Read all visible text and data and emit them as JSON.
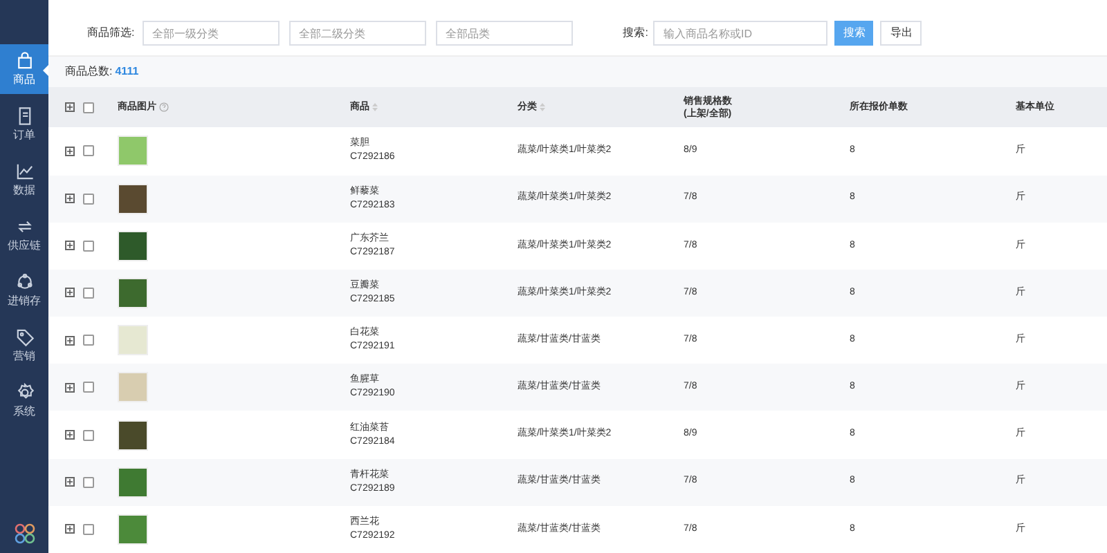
{
  "sidebar": {
    "items": [
      {
        "label": "商品",
        "selected": true
      },
      {
        "label": "订单",
        "selected": false
      },
      {
        "label": "数据",
        "selected": false
      },
      {
        "label": "供应链",
        "selected": false
      },
      {
        "label": "进销存",
        "selected": false
      },
      {
        "label": "营销",
        "selected": false
      },
      {
        "label": "系统",
        "selected": false
      }
    ]
  },
  "filter": {
    "label": "商品筛选:",
    "selects": [
      {
        "placeholder": "全部一级分类"
      },
      {
        "placeholder": "全部二级分类"
      },
      {
        "placeholder": "全部品类"
      }
    ],
    "search_label": "搜索:",
    "search": {
      "placeholder": "输入商品名称或ID"
    },
    "search_button": "搜索",
    "export_button": "导出"
  },
  "summary": {
    "label": "商品总数:",
    "count": "4111"
  },
  "table": {
    "all_checked": false,
    "columns": [
      {
        "label": "商品图片"
      },
      {
        "label": "商品"
      },
      {
        "label": "分类"
      },
      {
        "label": "销售规格数",
        "sublabel": "(上架/全部)"
      },
      {
        "label": "所在报价单数"
      },
      {
        "label": "基本单位"
      }
    ],
    "rows": [
      {
        "name": "菜胆",
        "id": "C7292186",
        "category": "蔬菜/叶菜类1/叶菜类2",
        "specs": "8/9",
        "quotes": "8",
        "unit": "斤",
        "checked": false,
        "color": "#8fc86a"
      },
      {
        "name": "鲜藜菜",
        "id": "C7292183",
        "category": "蔬菜/叶菜类1/叶菜类2",
        "specs": "7/8",
        "quotes": "8",
        "unit": "斤",
        "checked": false,
        "color": "#5a4a30"
      },
      {
        "name": "广东芥兰",
        "id": "C7292187",
        "category": "蔬菜/叶菜类1/叶菜类2",
        "specs": "7/8",
        "quotes": "8",
        "unit": "斤",
        "checked": false,
        "color": "#2e5a2a"
      },
      {
        "name": "豆瓣菜",
        "id": "C7292185",
        "category": "蔬菜/叶菜类1/叶菜类2",
        "specs": "7/8",
        "quotes": "8",
        "unit": "斤",
        "checked": false,
        "color": "#3d6a2e"
      },
      {
        "name": "白花菜",
        "id": "C7292191",
        "category": "蔬菜/甘蓝类/甘蓝类",
        "specs": "7/8",
        "quotes": "8",
        "unit": "斤",
        "checked": false,
        "color": "#e6e8d2"
      },
      {
        "name": "鱼腥草",
        "id": "C7292190",
        "category": "蔬菜/甘蓝类/甘蓝类",
        "specs": "7/8",
        "quotes": "8",
        "unit": "斤",
        "checked": false,
        "color": "#d8cdb0"
      },
      {
        "name": "红油菜苔",
        "id": "C7292184",
        "category": "蔬菜/叶菜类1/叶菜类2",
        "specs": "8/9",
        "quotes": "8",
        "unit": "斤",
        "checked": false,
        "color": "#4a4a2a"
      },
      {
        "name": "青杆花菜",
        "id": "C7292189",
        "category": "蔬菜/甘蓝类/甘蓝类",
        "specs": "7/8",
        "quotes": "8",
        "unit": "斤",
        "checked": false,
        "color": "#3f7a32"
      },
      {
        "name": "西兰花",
        "id": "C7292192",
        "category": "蔬菜/甘蓝类/甘蓝类",
        "specs": "7/8",
        "quotes": "8",
        "unit": "斤",
        "checked": false,
        "color": "#4c8a3a"
      }
    ]
  }
}
